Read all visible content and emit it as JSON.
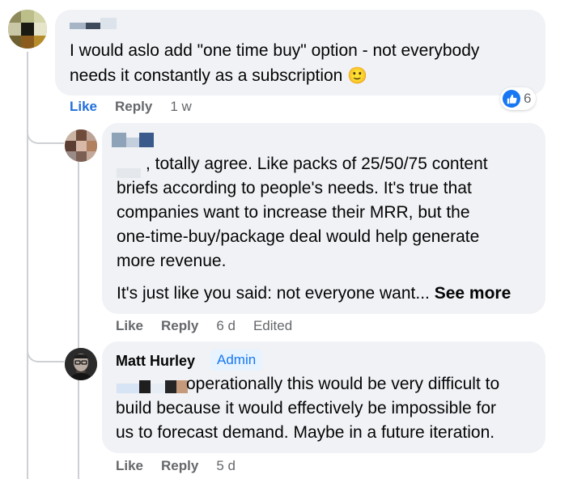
{
  "comments": [
    {
      "text": "I would aslo add \"one time buy\" option - not everybody needs it constantly as a subscription 🙂",
      "line1": "I would aslo add \"one time buy\" option - not everybody",
      "line2": "needs it constantly as a subscription",
      "emoji": "🙂",
      "actions": {
        "like": "Like",
        "reply": "Reply",
        "time": "1 w"
      },
      "reactions": {
        "icon": "thumbs-up-icon",
        "count": "6"
      }
    },
    {
      "line1": ", totally agree. Like packs of 25/50/75 content",
      "line2": "briefs according to people's needs. It's true that",
      "line3": "companies want to increase their MRR, but the",
      "line4": "one-time-buy/package deal would help generate",
      "line5": "more revenue.",
      "line6": "It's just like you said: not everyone want...",
      "see_more": "See more",
      "actions": {
        "like": "Like",
        "reply": "Reply",
        "time": "6 d",
        "edited": "Edited"
      }
    },
    {
      "author": "Matt Hurley",
      "badge": "Admin",
      "line1": "operationally this would be very difficult to",
      "line2": "build because it would effectively be impossible for",
      "line3": "us to forecast demand. Maybe in a future iteration.",
      "actions": {
        "like": "Like",
        "reply": "Reply",
        "time": "5 d"
      }
    }
  ],
  "colors": {
    "bubble_bg": "#f0f2f5",
    "active_like": "#216fdb",
    "muted": "#65676b",
    "admin_bg": "#e7f3ff",
    "admin_text": "#1877f2"
  }
}
